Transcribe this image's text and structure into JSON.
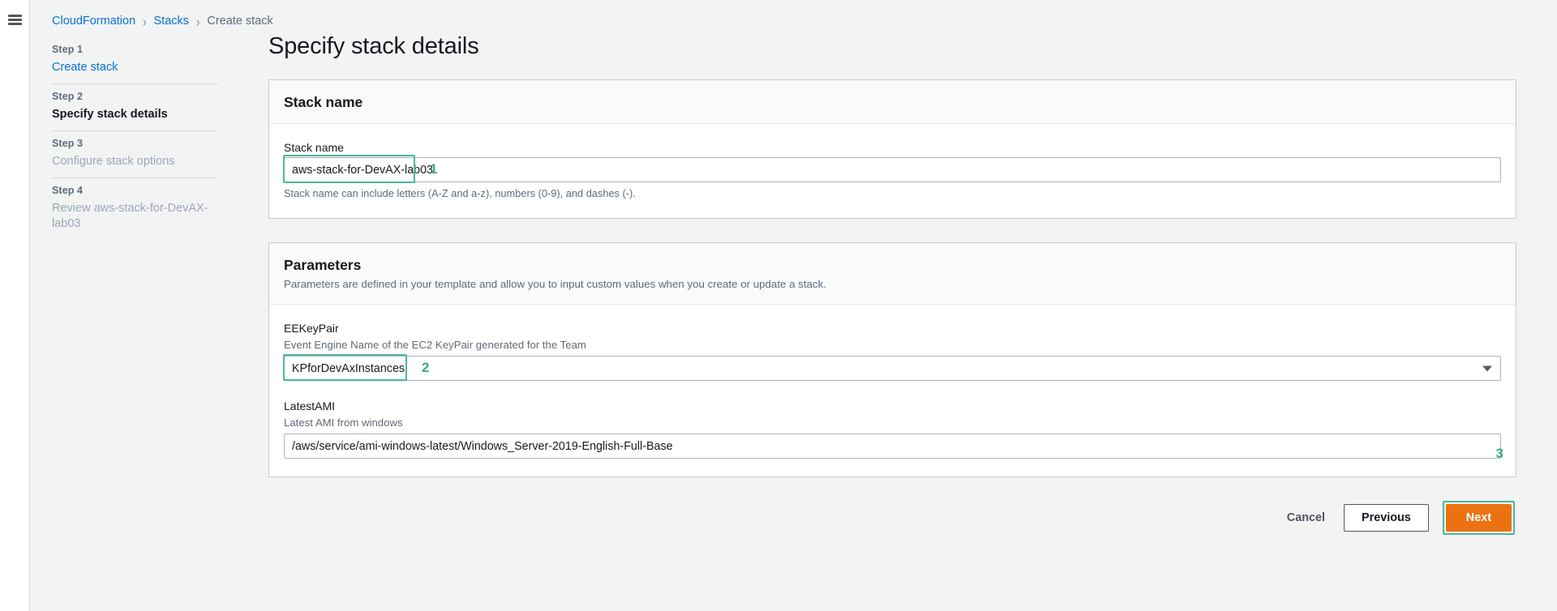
{
  "nav": {
    "menu_icon": "hamburger-menu-icon",
    "breadcrumb": {
      "items": [
        {
          "label": "CloudFormation",
          "type": "link"
        },
        {
          "label": "Stacks",
          "type": "link"
        },
        {
          "label": "Create stack",
          "type": "current"
        }
      ],
      "separator": "›"
    }
  },
  "sidebar": {
    "steps": [
      {
        "number": "Step 1",
        "title": "Create stack",
        "state": "link"
      },
      {
        "number": "Step 2",
        "title": "Specify stack details",
        "state": "active"
      },
      {
        "number": "Step 3",
        "title": "Configure stack options",
        "state": "muted"
      },
      {
        "number": "Step 4",
        "title": "Review aws-stack-for-DevAX-lab03",
        "state": "muted"
      }
    ]
  },
  "main": {
    "page_title": "Specify stack details",
    "stack_name_card": {
      "title": "Stack name",
      "field": {
        "label": "Stack name",
        "value": "aws-stack-for-DevAX-lab03",
        "placeholder": "Stack name",
        "hint": "Stack name can include letters (A-Z and a-z), numbers (0-9), and dashes (-)."
      }
    },
    "parameters_card": {
      "title": "Parameters",
      "subtitle": "Parameters are defined in your template and allow you to input custom values when you create or update a stack.",
      "fields": [
        {
          "label": "EEKeyPair",
          "description": "Event Engine Name of the EC2 KeyPair generated for the Team",
          "value": "KPforDevAxInstances",
          "placeholder": "Select a key pair",
          "control": "select",
          "caret_icon": "chevron-down-icon"
        },
        {
          "label": "LatestAMI",
          "description": "Latest AMI from windows",
          "value": "/aws/service/ami-windows-latest/Windows_Server-2019-English-Full-Base",
          "placeholder": "AMI path",
          "control": "text"
        }
      ]
    },
    "actions": {
      "cancel": "Cancel",
      "previous": "Previous",
      "next": "Next"
    }
  },
  "annotations": {
    "one": "1",
    "two": "2",
    "three": "3"
  },
  "colors": {
    "link": "#0972d3",
    "annotation": "#3aa98a",
    "annotation_border": "#4cb79b",
    "primary_button": "#ec7211",
    "page_background": "#f2f3f3"
  }
}
